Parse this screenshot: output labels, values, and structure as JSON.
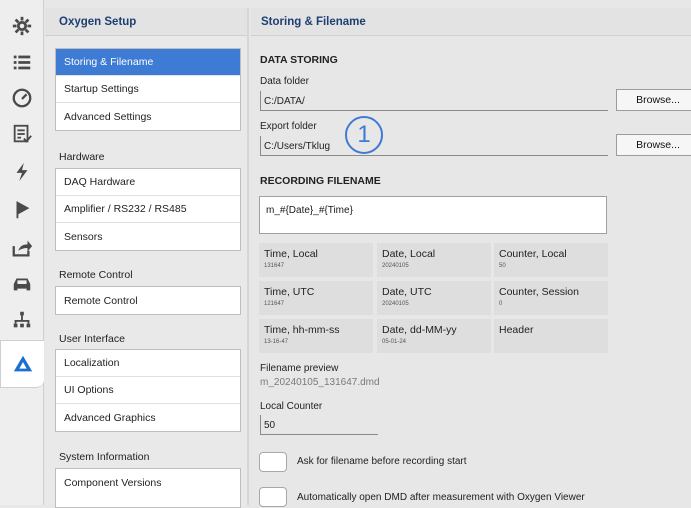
{
  "rail": {
    "icons": [
      "gear-icon",
      "list-icon",
      "gauge-icon",
      "report-icon",
      "lightning-icon",
      "flag-icon",
      "export-icon",
      "car-icon",
      "network-icon",
      "logo-icon"
    ]
  },
  "left_panel": {
    "title": "Oxygen Setup",
    "group1": [
      "Storing & Filename",
      "Startup Settings",
      "Advanced Settings"
    ],
    "hardware_label": "Hardware",
    "hardware": [
      "DAQ Hardware",
      "Amplifier / RS232 / RS485",
      "Sensors"
    ],
    "remote_label": "Remote Control",
    "remote": [
      "Remote Control"
    ],
    "ui_label": "User Interface",
    "ui": [
      "Localization",
      "UI Options",
      "Advanced Graphics"
    ],
    "sysinfo_label": "System Information",
    "sysinfo": [
      "Component Versions"
    ]
  },
  "right_panel": {
    "title": "Storing & Filename",
    "data_storing": "DATA STORING",
    "data_folder_label": "Data folder",
    "data_folder_value": "C:/DATA/",
    "browse": "Browse...",
    "export_folder_label": "Export folder",
    "export_folder_value": "C:/Users/Tklug",
    "annotation": "1",
    "recording_filename": "RECORDING FILENAME",
    "filename_pattern": "m_#{Date}_#{Time}",
    "tiles": [
      {
        "title": "Time, Local",
        "sub": "131647"
      },
      {
        "title": "Date, Local",
        "sub": "20240105"
      },
      {
        "title": "Counter, Local",
        "sub": "50"
      },
      {
        "title": "Time, UTC",
        "sub": "121647"
      },
      {
        "title": "Date, UTC",
        "sub": "20240105"
      },
      {
        "title": "Counter, Session",
        "sub": "0"
      },
      {
        "title": "Time, hh-mm-ss",
        "sub": "13-16-47"
      },
      {
        "title": "Date, dd-MM-yy",
        "sub": "05-01-24"
      },
      {
        "title": "Header",
        "sub": ""
      }
    ],
    "preview_label": "Filename preview",
    "preview_value": "m_20240105_131647.dmd",
    "local_counter_label": "Local Counter",
    "local_counter_value": "50",
    "ask_label": "Ask for filename before recording start",
    "auto_open_label": "Automatically open DMD after measurement with Oxygen Viewer"
  },
  "colors": {
    "accent": "#3d7bd4",
    "header_text": "#1e3f73"
  }
}
